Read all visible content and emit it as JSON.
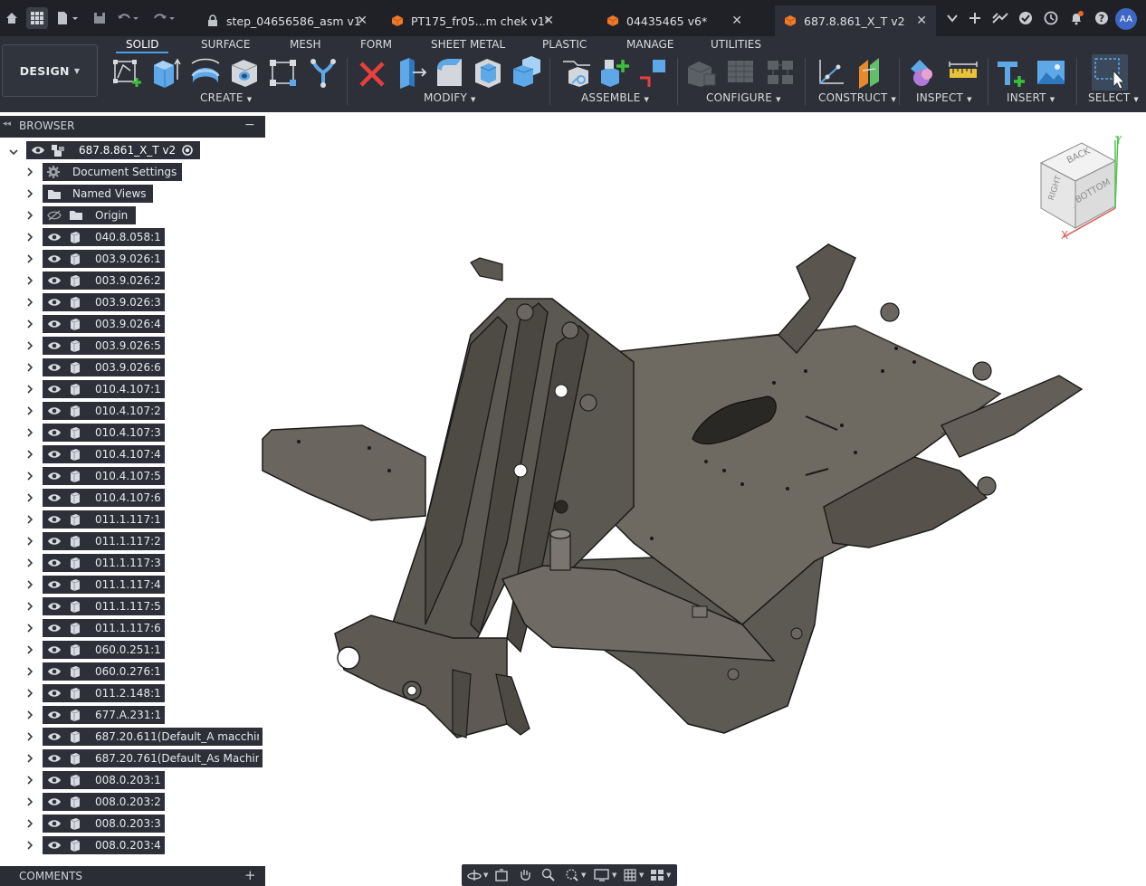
{
  "titlebar": {
    "tabs": [
      {
        "label": "step_04656586_asm v1",
        "icon": "lock-icon",
        "close": "✕"
      },
      {
        "label": "PT175_fr05...m chek v1*",
        "icon": "orange-box-icon",
        "close": "✕"
      },
      {
        "label": "04435465 v6*",
        "icon": "orange-box-icon",
        "close": "✕"
      },
      {
        "label": "687.8.861_X_T v2",
        "icon": "orange-box-icon",
        "close": "✕"
      }
    ],
    "user_initials": "AA"
  },
  "toolbar": {
    "workspace_label": "DESIGN",
    "workspace_tabs": [
      "SOLID",
      "SURFACE",
      "MESH",
      "FORM",
      "SHEET METAL",
      "PLASTIC",
      "MANAGE",
      "UTILITIES"
    ],
    "active_tab": "SOLID",
    "groups": [
      "CREATE",
      "MODIFY",
      "ASSEMBLE",
      "CONFIGURE",
      "CONSTRUCT",
      "INSPECT",
      "INSERT",
      "SELECT"
    ]
  },
  "browser": {
    "title": "BROWSER",
    "collapse": "−",
    "root": "687.8.861_X_T v2",
    "items": [
      {
        "label": "Document Settings",
        "type": "settings"
      },
      {
        "label": "Named Views",
        "type": "folder"
      },
      {
        "label": "Origin",
        "type": "folder-hidden"
      },
      {
        "label": "040.8.058:1",
        "type": "component"
      },
      {
        "label": "003.9.026:1",
        "type": "component"
      },
      {
        "label": "003.9.026:2",
        "type": "component"
      },
      {
        "label": "003.9.026:3",
        "type": "component"
      },
      {
        "label": "003.9.026:4",
        "type": "component"
      },
      {
        "label": "003.9.026:5",
        "type": "component"
      },
      {
        "label": "003.9.026:6",
        "type": "component"
      },
      {
        "label": "010.4.107:1",
        "type": "component"
      },
      {
        "label": "010.4.107:2",
        "type": "component"
      },
      {
        "label": "010.4.107:3",
        "type": "component"
      },
      {
        "label": "010.4.107:4",
        "type": "component"
      },
      {
        "label": "010.4.107:5",
        "type": "component"
      },
      {
        "label": "010.4.107:6",
        "type": "component"
      },
      {
        "label": "011.1.117:1",
        "type": "component"
      },
      {
        "label": "011.1.117:2",
        "type": "component"
      },
      {
        "label": "011.1.117:3",
        "type": "component"
      },
      {
        "label": "011.1.117:4",
        "type": "component"
      },
      {
        "label": "011.1.117:5",
        "type": "component"
      },
      {
        "label": "011.1.117:6",
        "type": "component"
      },
      {
        "label": "060.0.251:1",
        "type": "component"
      },
      {
        "label": "060.0.276:1",
        "type": "component"
      },
      {
        "label": "011.2.148:1",
        "type": "component"
      },
      {
        "label": "677.A.231:1",
        "type": "component"
      },
      {
        "label": "687.20.611(Default_A macchin...",
        "type": "component"
      },
      {
        "label": "687.20.761(Default_As Machin...",
        "type": "component"
      },
      {
        "label": "008.0.203:1",
        "type": "component"
      },
      {
        "label": "008.0.203:2",
        "type": "component"
      },
      {
        "label": "008.0.203:3",
        "type": "component"
      },
      {
        "label": "008.0.203:4",
        "type": "component"
      }
    ]
  },
  "comments": {
    "title": "COMMENTS",
    "add": "+"
  },
  "viewcube": {
    "faces": [
      "BACK",
      "RIGHT",
      "BOTTOM"
    ],
    "axis_x": "X",
    "axis_y": "Y"
  },
  "colors": {
    "accent": "#4aa0e6",
    "panel": "#2d3038",
    "topbar": "#1f2127",
    "model": "#5a5650"
  }
}
